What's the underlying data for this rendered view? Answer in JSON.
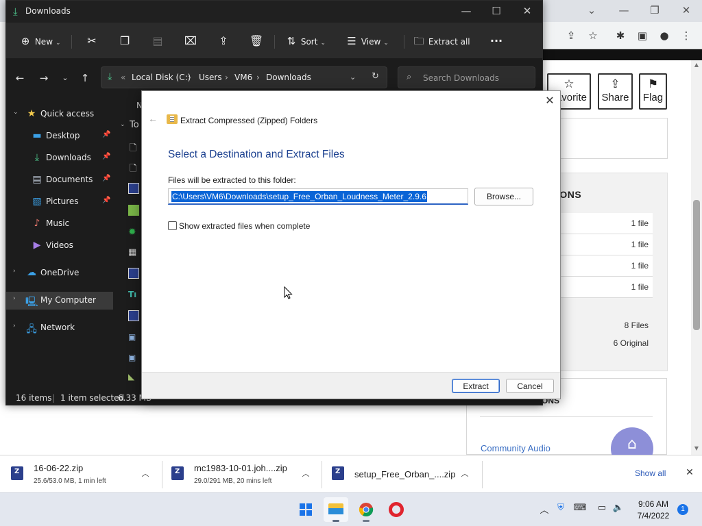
{
  "explorer": {
    "title": "Downloads",
    "commands": {
      "new": "New",
      "sort": "Sort",
      "view": "View",
      "extract_all": "Extract all"
    },
    "address": {
      "disk": "Local Disk (C:)",
      "users": "Users",
      "user": "VM6",
      "folder": "Downloads"
    },
    "search_placeholder": "Search Downloads",
    "nav": {
      "quick_access": "Quick access",
      "desktop": "Desktop",
      "downloads": "Downloads",
      "documents": "Documents",
      "pictures": "Pictures",
      "music": "Music",
      "videos": "Videos",
      "onedrive": "OneDrive",
      "my_computer": "My Computer",
      "network": "Network"
    },
    "content_header_partial": "N",
    "content_group_partial": "To",
    "status": {
      "items": "16 items",
      "selected": "1 item selected",
      "size": "6.33 MB"
    }
  },
  "dialog": {
    "title": "Extract Compressed (Zipped) Folders",
    "heading": "Select a Destination and Extract Files",
    "folder_label": "Files will be extracted to this folder:",
    "path": "C:\\Users\\VM6\\Downloads\\setup_Free_Orban_Loudness_Meter_2.9.6",
    "browse": "Browse...",
    "show_files_label": "Show extracted files when complete",
    "show_files_checked": false,
    "extract": "Extract",
    "cancel": "Cancel"
  },
  "browser_page": {
    "favorite_partial": "avorite",
    "share": "Share",
    "flag": "Flag",
    "files_heading_partial": "IONS",
    "file_rows": [
      "1 file",
      "1 file",
      "1 file",
      "1 file"
    ],
    "total_files": "8 Files",
    "original": "6 Original",
    "box2_heading_partial": "ONS",
    "community_link": "Community Audio"
  },
  "downloads_shelf": {
    "items": [
      {
        "name": "16-06-22.zip",
        "status": "25.6/53.0 MB, 1 min left"
      },
      {
        "name": "mc1983-10-01.joh....zip",
        "status": "29.0/291 MB, 20 mins left"
      },
      {
        "name": "setup_Free_Orban_....zip",
        "status": ""
      }
    ],
    "show_all": "Show all"
  },
  "taskbar": {
    "time": "9:06 AM",
    "date": "7/4/2022",
    "notifications": "1"
  },
  "colors": {
    "explorer_bg": "#1c1c1c",
    "dialog_heading": "#1a3f8f",
    "selection": "#0a64d6",
    "link": "#3b6fc4",
    "accent": "#1a73e8"
  }
}
